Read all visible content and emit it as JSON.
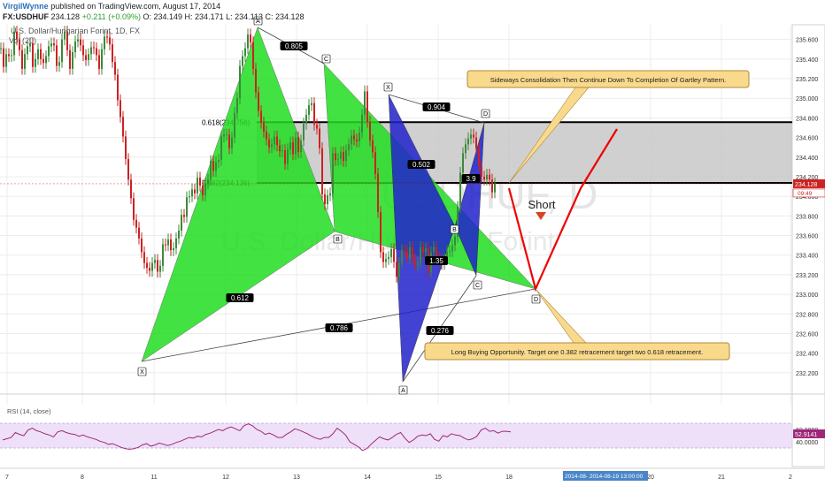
{
  "header": {
    "author": "VirgilWynne",
    "published": "published on TradingView.com, August 17, 2014",
    "symbol": "FX:USDHUF",
    "last": "234.128",
    "change": "+0.211 (+0.09%)",
    "open": "O: 234.149",
    "high": "H: 234.171",
    "low": "L: 234.113",
    "close": "C: 234.128",
    "instrument": "U.S. Dollar/Hungarian Forint, 1D, FX",
    "volume": "Vol (20)"
  },
  "watermark": {
    "top": "USDHUF, D",
    "bottom": "U.S. Dollar/Hungarian Forint"
  },
  "colors": {
    "bull": "#3a8a3a",
    "bear": "#cc2222",
    "pattern1": "#22dd22",
    "pattern2": "#2222cc",
    "zone": "#c8c8c8",
    "callout": "#f9d98b",
    "projection": "#ee0000",
    "rsi_band": "#ede0f8",
    "rsi_line": "#a0267a",
    "price_marker": "#cc2222",
    "rsi_marker": "#a0267a"
  },
  "price_axis": {
    "ticks": [
      "235.600",
      "235.400",
      "235.200",
      "235.000",
      "234.800",
      "234.600",
      "234.400",
      "234.200",
      "234.000",
      "233.800",
      "233.600",
      "233.400",
      "233.200",
      "233.000",
      "232.800",
      "232.600",
      "232.400",
      "232.200"
    ],
    "current": "234.128",
    "countdown": "09:49"
  },
  "time_axis": {
    "labels": [
      "7",
      "8",
      "11",
      "12",
      "13",
      "14",
      "15",
      "18",
      "20",
      "21",
      "2"
    ],
    "cursor": "2014-08-  2014-08-19 13:00:00"
  },
  "annotations": {
    "callout_top": "Sideways Consolidation Then Continue Down To Completion Of Gartley Pattern.",
    "callout_bottom": "Long Buying Opportunity. Target one 0.382 retracement target two 0.618 retracement.",
    "short": "Short",
    "fib_upper": "0.618(234.756)",
    "fib_lower": "0.382(234.136)"
  },
  "pattern_labels": {
    "green": {
      "X": "X",
      "A": "A",
      "B": "B",
      "C": "C",
      "D": "D"
    },
    "blue": {
      "X": "X",
      "A": "A",
      "B": "B",
      "C": "C",
      "D": "D"
    }
  },
  "pattern_ratios": [
    "0.805",
    "0.612",
    "0.786",
    "0.904",
    "0.502",
    "3.9",
    "0.276",
    "1.35"
  ],
  "rsi": {
    "title": "RSI (14, close)",
    "ticks": [
      "60.0000",
      "40.0000"
    ],
    "current": "52.9141"
  },
  "chart_data": {
    "type": "line",
    "title": "FX:USDHUF",
    "ylim": [
      232.0,
      235.75
    ],
    "grid": true,
    "price": {
      "x": [
        0,
        3,
        6,
        9,
        12,
        15,
        18,
        21,
        24,
        27,
        30,
        33,
        36,
        39,
        42,
        45,
        48,
        51,
        54,
        57,
        60,
        63,
        66,
        69,
        72,
        75,
        78,
        81,
        84,
        87,
        90,
        93,
        96,
        99,
        102,
        105,
        108,
        111,
        114,
        117,
        120,
        123,
        126,
        129,
        132,
        135,
        138,
        141,
        144,
        147,
        150,
        153,
        156,
        159,
        162,
        165,
        168,
        171,
        174,
        177,
        180,
        183,
        186,
        189,
        192,
        195,
        198,
        201,
        204,
        207,
        210,
        213,
        216,
        219,
        222,
        225,
        228,
        231,
        234,
        237,
        240,
        243,
        246,
        249,
        252,
        255,
        258,
        261,
        264,
        267,
        270,
        273,
        276,
        279,
        282,
        285,
        288,
        291,
        294,
        297,
        300,
        303,
        306,
        309,
        312,
        315,
        318,
        321,
        324,
        327,
        330,
        333,
        336,
        339,
        342,
        345,
        348,
        351,
        354,
        357,
        360,
        363,
        366,
        369,
        372,
        375,
        378,
        381,
        384,
        387,
        390,
        393,
        396,
        399,
        402,
        405,
        408,
        411,
        414,
        417,
        420,
        423,
        426,
        429,
        432,
        435,
        438,
        441,
        444,
        447,
        450,
        453,
        456,
        459,
        462,
        465,
        468,
        471,
        474,
        477,
        480,
        483,
        486,
        489,
        492,
        495,
        498,
        501,
        504,
        507,
        510,
        513,
        516,
        519,
        522,
        525,
        528,
        531,
        534,
        537,
        540,
        543,
        546,
        549,
        552,
        555,
        558,
        561,
        564,
        567,
        570,
        573,
        576
      ],
      "values": [
        235.51,
        235.32,
        235.45,
        235.43,
        235.44,
        235.68,
        235.6,
        235.49,
        235.3,
        235.45,
        235.53,
        235.56,
        235.32,
        235.4,
        235.5,
        235.4,
        235.36,
        235.43,
        235.53,
        235.56,
        235.54,
        235.33,
        235.37,
        235.6,
        235.68,
        235.49,
        235.3,
        235.47,
        235.58,
        235.6,
        235.54,
        235.44,
        235.39,
        235.45,
        235.52,
        235.51,
        235.44,
        235.3,
        235.5,
        235.63,
        235.62,
        235.55,
        235.37,
        235.24,
        234.98,
        234.81,
        234.61,
        234.38,
        234.17,
        233.98,
        233.76,
        233.68,
        233.57,
        233.43,
        233.32,
        233.27,
        233.24,
        233.32,
        233.35,
        233.23,
        233.29,
        233.51,
        233.5,
        233.56,
        233.45,
        233.47,
        233.57,
        233.65,
        233.81,
        233.79,
        233.99,
        234.0,
        234.07,
        234.03,
        234.19,
        234.11,
        234.01,
        234.13,
        234.17,
        234.36,
        234.26,
        234.35,
        234.37,
        234.61,
        234.63,
        234.63,
        234.49,
        234.6,
        234.85,
        235.0,
        235.33,
        235.43,
        235.51,
        235.65,
        235.57,
        235.3,
        235.06,
        234.87,
        234.75,
        234.66,
        234.58,
        234.5,
        234.53,
        234.61,
        234.52,
        234.46,
        234.47,
        234.33,
        234.48,
        234.55,
        234.43,
        234.6,
        234.45,
        234.57,
        234.74,
        234.83,
        234.93,
        234.95,
        234.73,
        234.69,
        234.49,
        234.02,
        233.92,
        234.01,
        234.03,
        234.44,
        234.37,
        234.38,
        234.45,
        234.36,
        234.47,
        234.53,
        234.62,
        234.58,
        234.56,
        234.65,
        234.83,
        235.07,
        234.76,
        234.57,
        234.45,
        234.23,
        233.84,
        233.43,
        233.33,
        233.36,
        233.38,
        233.46,
        233.33,
        233.18,
        233.32,
        233.45,
        233.44,
        233.37,
        233.48,
        233.36,
        233.3,
        233.32,
        233.48,
        233.43,
        233.47,
        233.23,
        233.43,
        233.48,
        233.37,
        233.36,
        233.31,
        233.36,
        233.44,
        233.44,
        233.5,
        233.59,
        233.89,
        234.24,
        234.44,
        234.53,
        234.59,
        234.63,
        234.6,
        234.49,
        234.31,
        234.2,
        234.17,
        234.22,
        234.17,
        234.04,
        234.13
      ]
    },
    "rsi_series": {
      "name": "RSI (14, close)",
      "values": [
        43,
        45,
        47,
        55,
        52,
        50,
        59,
        62,
        58,
        56,
        53,
        51,
        48,
        56,
        58,
        55,
        53,
        52,
        49,
        51,
        48,
        46,
        44,
        41,
        39,
        36,
        37,
        34,
        31,
        29,
        28,
        29,
        31,
        35,
        37,
        33,
        35,
        38,
        36,
        34,
        36,
        39,
        41,
        44,
        47,
        46,
        49,
        48,
        52,
        54,
        57,
        60,
        58,
        62,
        64,
        61,
        58,
        66,
        69,
        66,
        60,
        57,
        52,
        54,
        51,
        47,
        47,
        52,
        56,
        61,
        59,
        56,
        53,
        49,
        46,
        44,
        47,
        47,
        53,
        62,
        57,
        51,
        40,
        36,
        32,
        26,
        29,
        36,
        42,
        48,
        45,
        43,
        47,
        52,
        55,
        46,
        39,
        43,
        49,
        51,
        50,
        53,
        44,
        41,
        50,
        48,
        53,
        51,
        50,
        46,
        43,
        45,
        49,
        59,
        62,
        57,
        58,
        54,
        57,
        57,
        56
      ],
      "ylim": [
        0,
        100
      ]
    },
    "fib_levels": [
      {
        "name": "0.618",
        "value": 234.756
      },
      {
        "name": "0.382",
        "value": 234.136
      }
    ]
  }
}
